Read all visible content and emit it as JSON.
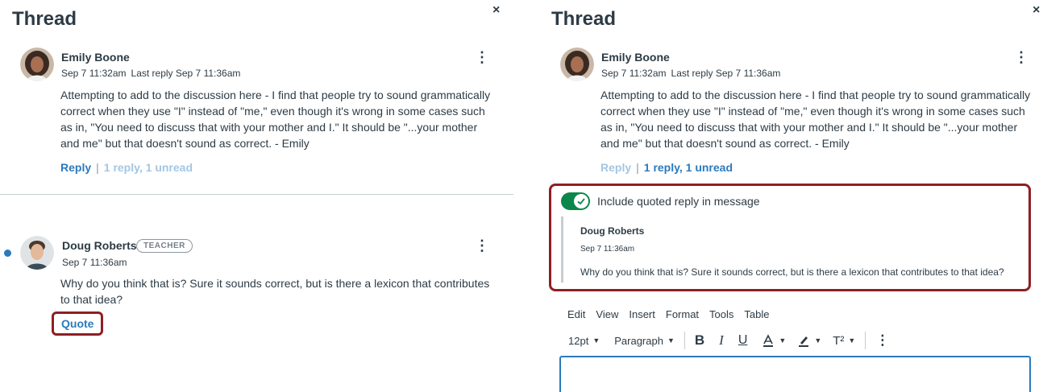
{
  "left": {
    "title": "Thread",
    "close": "×",
    "post1": {
      "author": "Emily Boone",
      "date": "Sep 7 11:32am",
      "last_reply": "Last reply Sep 7 11:36am",
      "text": "Attempting to add to the discussion here - I find that people try to sound grammatically correct when they use \"I\" instead of \"me,\" even though it's wrong in some cases such as in, \"You need to discuss that with your mother and I.\" It should be \"...your mother and me\" but that doesn't sound as correct. - Emily",
      "reply": "Reply",
      "replies": "1 reply, 1 unread"
    },
    "post2": {
      "author": "Doug Roberts",
      "badge": "TEACHER",
      "date": "Sep 7 11:36am",
      "text": "Why do you think that is? Sure it sounds correct, but is there a lexicon that contributes to that idea?",
      "quote": "Quote"
    }
  },
  "right": {
    "title": "Thread",
    "close": "×",
    "post1": {
      "author": "Emily Boone",
      "date": "Sep 7 11:32am",
      "last_reply": "Last reply Sep 7 11:36am",
      "text": "Attempting to add to the discussion here - I find that people try to sound grammatically correct when they use \"I\" instead of \"me,\" even though it's wrong in some cases such as in, \"You need to discuss that with your mother and I.\" It should be \"...your mother and me\" but that doesn't sound as correct. - Emily",
      "reply": "Reply",
      "replies": "1 reply, 1 unread"
    },
    "toggle_label": "Include quoted reply in message",
    "quoted": {
      "author": "Doug Roberts",
      "date": "Sep 7 11:36am",
      "text": "Why do you think that is? Sure it sounds correct, but is there a lexicon that contributes to that idea?"
    },
    "menu": [
      "Edit",
      "View",
      "Insert",
      "Format",
      "Tools",
      "Table"
    ],
    "toolbar": {
      "font_size": "12pt",
      "paragraph": "Paragraph",
      "bold": "B",
      "italic": "I",
      "underline": "U",
      "superscript": "T²"
    }
  },
  "colors": {
    "link": "#2b7abc",
    "highlight": "#8e1f23",
    "toggle_on": "#0b874b",
    "text": "#2d3b45"
  }
}
